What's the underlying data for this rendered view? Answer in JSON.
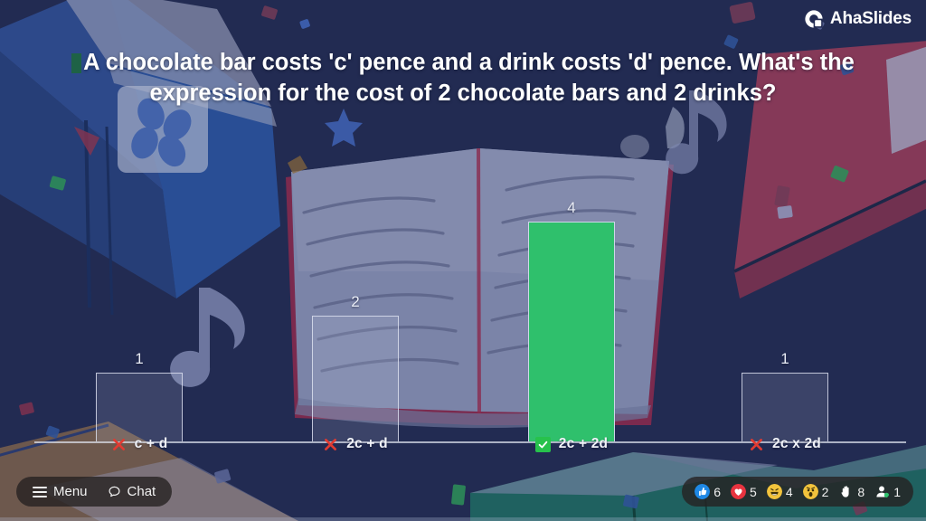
{
  "brand": {
    "name": "AhaSlides",
    "logo_icon": "ahaslides-logo-icon"
  },
  "question": {
    "text": "A chocolate bar costs 'c' pence and a drink costs 'd' pence. What's the expression for the cost of 2 chocolate bars and 2 drinks?"
  },
  "chart_data": {
    "type": "bar",
    "title": "A chocolate bar costs 'c' pence and a drink costs 'd' pence. What's the expression for the cost of 2 chocolate bars and 2 drinks?",
    "categories": [
      "c + d",
      "2c + d",
      "2c + 2d",
      "2c x 2d"
    ],
    "values": [
      1,
      2,
      4,
      1
    ],
    "data_labels": [
      "1",
      "2",
      "4",
      "1"
    ],
    "correct_index": 2,
    "correctness": [
      "incorrect",
      "incorrect",
      "correct",
      "incorrect"
    ],
    "xlabel": "",
    "ylabel": "",
    "ylim": [
      0,
      4
    ],
    "grid": false,
    "legend": "none",
    "colors": {
      "correct_bar": "#2fc06c",
      "bar_border": "#dee2f0",
      "axis": "#e1e4f0"
    }
  },
  "options": [
    {
      "label": "c + d",
      "votes": "1",
      "status": "incorrect",
      "status_icon": "red-x-icon"
    },
    {
      "label": "2c + d",
      "votes": "2",
      "status": "incorrect",
      "status_icon": "red-x-icon"
    },
    {
      "label": "2c + 2d",
      "votes": "4",
      "status": "correct",
      "status_icon": "green-check-icon"
    },
    {
      "label": "2c x 2d",
      "votes": "1",
      "status": "incorrect",
      "status_icon": "red-x-icon"
    }
  ],
  "toolbar": {
    "menu_label": "Menu",
    "menu_icon": "hamburger-icon",
    "chat_label": "Chat",
    "chat_icon": "chat-bubble-icon"
  },
  "reactions": [
    {
      "icon": "thumbs-up-icon",
      "count": "6",
      "color": "#1e88e5"
    },
    {
      "icon": "heart-icon",
      "count": "5",
      "color": "#e8333f"
    },
    {
      "icon": "laughing-face-icon",
      "count": "4",
      "color": "#f2c33c"
    },
    {
      "icon": "surprised-face-icon",
      "count": "2",
      "color": "#f2c33c"
    },
    {
      "icon": "raised-hand-icon",
      "count": "8",
      "color": "#ffffff"
    },
    {
      "icon": "participant-icon",
      "count": "1",
      "color": "#ffffff"
    }
  ],
  "theme": {
    "background": "#222b52",
    "accent_green": "#2fc06c",
    "accent_red": "#e53935"
  }
}
